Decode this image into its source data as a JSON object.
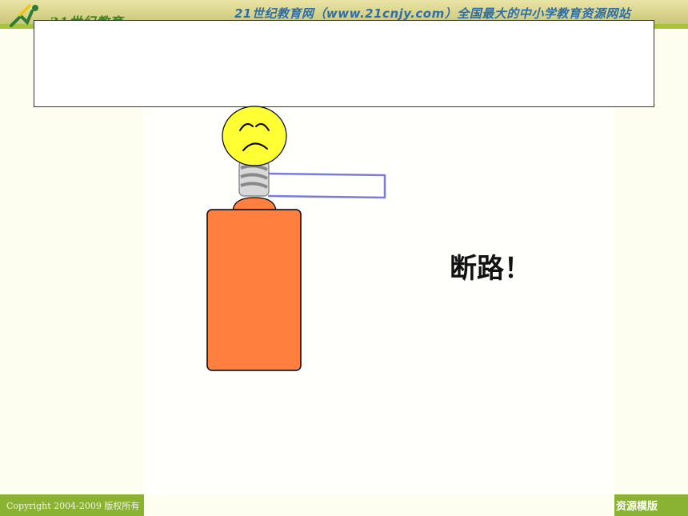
{
  "header": {
    "logo_text": "21世纪教育",
    "site_title": "21世纪教育网（www.21cnjy.com）全国最大的中小学教育资源网站"
  },
  "slide": {
    "title": "",
    "caption": "断路！"
  },
  "diagram": {
    "bulb_expression": "sad",
    "circuit_state": "open"
  },
  "footer": {
    "copyright": "Copyright 2004-2009 版权所有",
    "right_text": "资源模版"
  },
  "colors": {
    "bulb": "#ffff33",
    "battery": "#ff7f3f",
    "wire": "#7b7bdc",
    "accent_green": "#8ab333"
  }
}
